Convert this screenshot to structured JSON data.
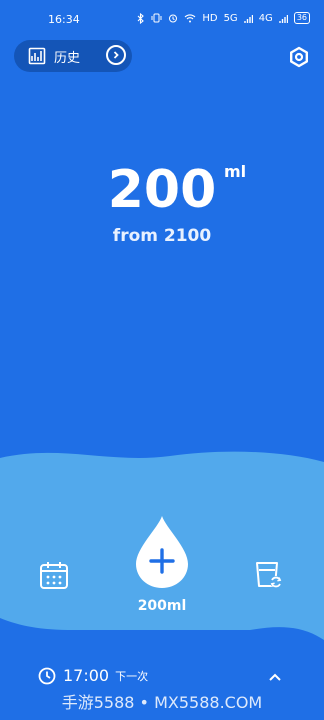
{
  "status_bar": {
    "time": "16:34",
    "icons": [
      "bluetooth-icon",
      "vibrate-icon",
      "alarm-icon",
      "wifi-icon"
    ],
    "network": "HD",
    "signal1": "5G",
    "signal2": "4G",
    "battery": "36"
  },
  "header": {
    "history_label": "历史",
    "history_icon": "chart-icon",
    "arrow_icon": "chevron-right-icon",
    "settings_icon": "gear-icon"
  },
  "intake": {
    "current": "200",
    "unit": "ml",
    "goal_text": "from 2100"
  },
  "actions": {
    "calendar_icon": "calendar-icon",
    "drink_icon": "water-drop-plus-icon",
    "drink_label": "200ml",
    "cup_icon": "cup-switch-icon"
  },
  "reminder": {
    "time": "17:00",
    "label": "下一次",
    "clock_icon": "clock-icon",
    "expand_icon": "chevron-up-icon"
  },
  "watermark": "手游5588 • MX5588.COM",
  "colors": {
    "background": "#1f6fe6",
    "water": "#52a9ec",
    "pill": "#1455b7"
  }
}
